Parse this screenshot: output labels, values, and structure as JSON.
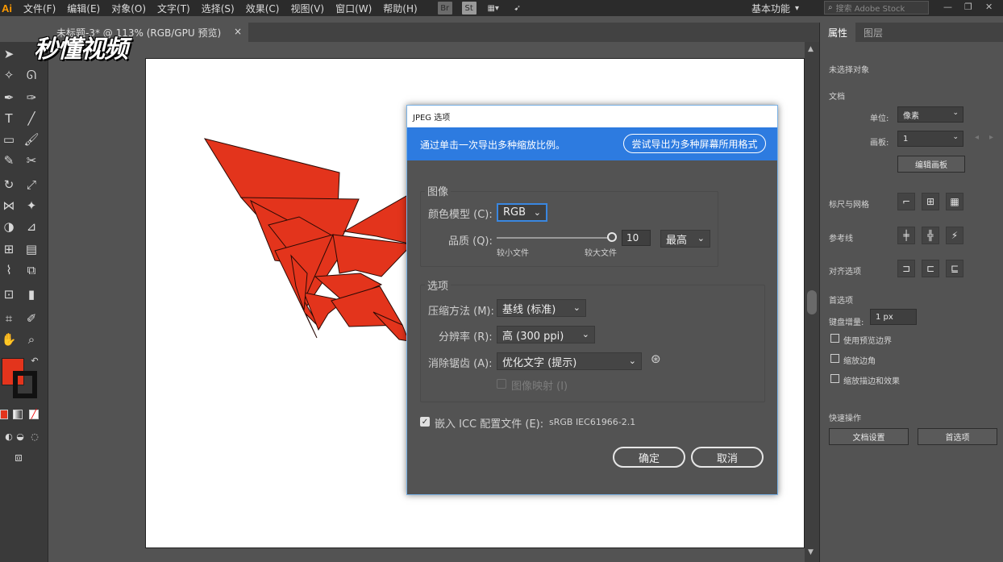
{
  "menubar": {
    "logo": "Ai",
    "items": [
      "文件(F)",
      "编辑(E)",
      "对象(O)",
      "文字(T)",
      "选择(S)",
      "效果(C)",
      "视图(V)",
      "窗口(W)",
      "帮助(H)"
    ],
    "workspace": "基本功能",
    "search_placeholder": "搜索 Adobe Stock"
  },
  "document_tab": {
    "title": "未标题-3* @ 113% (RGB/GPU 预览)",
    "close": "×"
  },
  "watermark": "秒懂视频",
  "colors": {
    "fill": "#e3341c",
    "dialog_banner": "#2d7be0",
    "focus": "#3a87e0"
  },
  "right_panel": {
    "tabs": [
      "属性",
      "图层"
    ],
    "no_selection": "未选择对象",
    "document_heading": "文档",
    "units_label": "单位:",
    "units_value": "像素",
    "artboard_label": "画板:",
    "artboard_value": "1",
    "edit_artboard_btn": "编辑画板",
    "rulers_grids": "标尺与网格",
    "guides": "参考线",
    "align_options": "对齐选项",
    "preferences_heading": "首选项",
    "keyboard_increment_label": "键盘增量:",
    "keyboard_increment_value": "1 px",
    "checkboxes": [
      "使用预览边界",
      "缩放边角",
      "缩放描边和效果"
    ],
    "quick_actions_heading": "快速操作",
    "doc_setup_btn": "文档设置",
    "prefs_btn": "首选项"
  },
  "dialog": {
    "title": "JPEG 选项",
    "banner_text": "通过单击一次导出多种缩放比例。",
    "banner_button": "尝试导出为多种屏幕所用格式",
    "image_section": "图像",
    "color_model_label": "颜色模型 (C):",
    "color_model_value": "RGB",
    "quality_label": "品质 (Q):",
    "quality_value": "10",
    "quality_max": 10,
    "quality_preset": "最高",
    "smaller_file": "较小文件",
    "larger_file": "较大文件",
    "options_section": "选项",
    "compression_label": "压缩方法 (M):",
    "compression_value": "基线 (标准)",
    "resolution_label": "分辨率 (R):",
    "resolution_value": "高 (300 ppi)",
    "antialias_label": "消除锯齿 (A):",
    "antialias_value": "优化文字 (提示)",
    "imagemap_label": "图像映射 (I)",
    "embed_icc_label": "嵌入 ICC 配置文件 (E):",
    "embed_icc_value": "sRGB IEC61966-2.1",
    "ok_btn": "确定",
    "cancel_btn": "取消"
  }
}
